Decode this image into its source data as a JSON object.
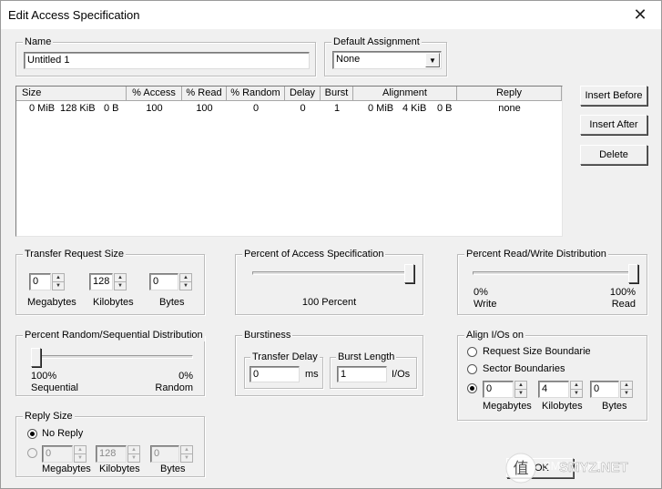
{
  "window": {
    "title": "Edit Access Specification",
    "close_glyph": "✕"
  },
  "name_group": {
    "legend": "Name",
    "value": "Untitled 1"
  },
  "default_assignment": {
    "legend": "Default Assignment",
    "value": "None",
    "arrow": "▼"
  },
  "table": {
    "headers": [
      "Size",
      "% Access",
      "% Read",
      "% Random",
      "Delay",
      "Burst",
      "Alignment",
      "Reply"
    ],
    "rows": [
      {
        "size_mib": "0 MiB",
        "size_kib": "128 KiB",
        "size_b": "0 B",
        "access": "100",
        "read": "100",
        "random": "0",
        "delay": "0",
        "burst": "1",
        "align_mib": "0 MiB",
        "align_kib": "4 KiB",
        "align_b": "0 B",
        "reply": "none"
      }
    ]
  },
  "side_buttons": {
    "insert_before": "Insert Before",
    "insert_after": "Insert After",
    "delete": "Delete"
  },
  "transfer_size": {
    "legend": "Transfer Request Size",
    "megabytes": "0",
    "kilobytes": "128",
    "bytes": "0",
    "labels": {
      "megabytes": "Megabytes",
      "kilobytes": "Kilobytes",
      "bytes": "Bytes"
    }
  },
  "percent_access": {
    "legend": "Percent of Access Specification",
    "caption": "100 Percent",
    "level": 1.0
  },
  "read_write": {
    "legend": "Percent Read/Write Distribution",
    "left_value": "0%",
    "left_label": "Write",
    "right_value": "100%",
    "right_label": "Read",
    "level": 1.0
  },
  "random_seq": {
    "legend": "Percent Random/Sequential Distribution",
    "left_value": "100%",
    "left_label": "Sequential",
    "right_value": "0%",
    "right_label": "Random",
    "level": 0.0
  },
  "burstiness": {
    "legend": "Burstiness",
    "transfer_delay": {
      "legend": "Transfer Delay",
      "value": "0",
      "unit": "ms"
    },
    "burst_length": {
      "legend": "Burst Length",
      "value": "1",
      "unit": "I/Os"
    }
  },
  "align": {
    "legend": "Align I/Os on",
    "opt_request": "Request Size Boundaries",
    "opt_sector": "Sector Boundaries",
    "megabytes": "0",
    "kilobytes": "4",
    "bytes": "0",
    "labels": {
      "megabytes": "Megabytes",
      "kilobytes": "Kilobytes",
      "bytes": "Bytes"
    }
  },
  "reply_size": {
    "legend": "Reply Size",
    "no_reply": "No Reply",
    "megabytes": "0",
    "kilobytes": "128",
    "bytes": "0",
    "labels": {
      "megabytes": "Megabytes",
      "kilobytes": "Kilobytes",
      "bytes": "Bytes"
    }
  },
  "footer": {
    "ok": "OK"
  },
  "watermark": {
    "brand": "SMYZ.NET",
    "glyph": "值"
  },
  "spin_glyphs": {
    "up": "▲",
    "down": "▼"
  },
  "radio_glyph_checked": "●"
}
